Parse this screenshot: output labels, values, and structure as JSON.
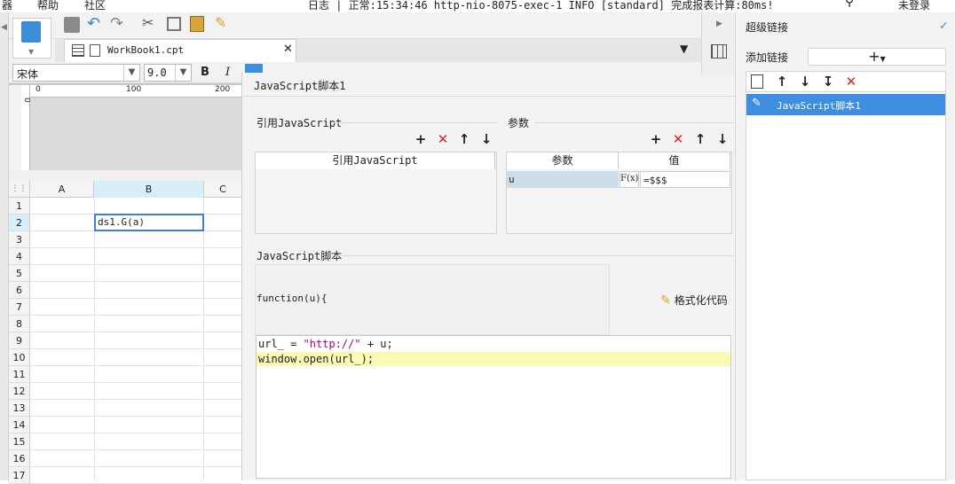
{
  "menubar": {
    "items": [
      "器",
      "帮助",
      "社区"
    ],
    "status": "日志 | 正常:15:34:46 http-nio-8075-exec-1 INFO [standard] 完成报表计算:80ms!",
    "login": "未登录"
  },
  "workbook": {
    "tab_name": "WorkBook1.cpt",
    "font_name": "宋体",
    "font_size": "9.0",
    "bold_label": "B",
    "italic_label": "I",
    "ruler_marks": [
      "0",
      "100",
      "200"
    ],
    "ruler_v_mark": "0",
    "columns": [
      "A",
      "B",
      "C"
    ],
    "rows": [
      "1",
      "2",
      "3",
      "4",
      "5",
      "6",
      "7",
      "8",
      "9",
      "10",
      "11",
      "12",
      "13",
      "14",
      "15",
      "16",
      "17"
    ],
    "cell_b2": "ds1.G(a)"
  },
  "dialog": {
    "title": "JavaScript脚本1",
    "ref_js_section": "引用JavaScript",
    "ref_js_column": "引用JavaScript",
    "params_section": "参数",
    "params_col_name": "参数",
    "params_col_value": "值",
    "param_rows": [
      {
        "name": "u",
        "value": "=$$$"
      }
    ],
    "formula_icon": "F(x)",
    "script_section": "JavaScript脚本",
    "function_header": "function(u){",
    "format_code": "格式化代码",
    "code_lines": [
      {
        "plain_before": "url_ = ",
        "str": "\"http://\"",
        "plain_after": " + u;"
      },
      {
        "plain_before": "window.open(url_);",
        "str": "",
        "plain_after": ""
      }
    ]
  },
  "right_panel": {
    "title": "超级链接",
    "add_label": "添加链接",
    "add_symbol": "+",
    "items": [
      "JavaScript脚本1"
    ]
  },
  "colors": {
    "accent": "#3d8ee0",
    "delete_red": "#e02020",
    "highlight_line": "#fafab4",
    "selected_col": "#d9eefb"
  }
}
